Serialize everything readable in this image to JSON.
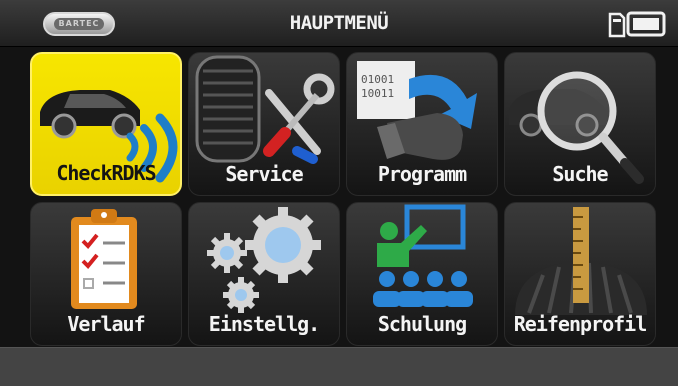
{
  "header": {
    "title": "HAUPTMENÜ",
    "logo_text": "BARTEC",
    "status_icons": [
      "sd-card-icon",
      "battery-icon"
    ]
  },
  "menu": {
    "selected_index": 0,
    "accent_color": "#f3e100",
    "items": [
      {
        "label": "CheckRDKS",
        "icon": "car-sensor-icon"
      },
      {
        "label": "Service",
        "icon": "tire-tools-icon"
      },
      {
        "label": "Programm",
        "icon": "program-sensor-icon"
      },
      {
        "label": "Suche",
        "icon": "car-magnifier-icon"
      },
      {
        "label": "Verlauf",
        "icon": "clipboard-checklist-icon"
      },
      {
        "label": "Einstellg.",
        "icon": "gears-icon"
      },
      {
        "label": "Schulung",
        "icon": "training-icon"
      },
      {
        "label": "Reifenprofil",
        "icon": "tread-depth-icon"
      }
    ]
  }
}
